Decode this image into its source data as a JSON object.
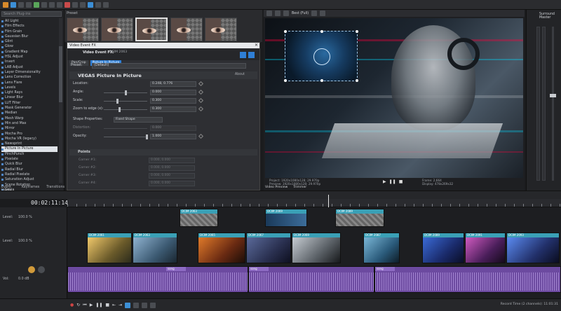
{
  "fx_list": {
    "search_placeholder": "Search Plug-ins",
    "items": [
      "All Light",
      "Film Effects",
      "Film Grain",
      "Gaussian Blur",
      "Glint",
      "Glow",
      "Gradient Map",
      "HSL Adjust",
      "Invert",
      "LAB Adjust",
      "Layer Dimensionality",
      "Lens Correction",
      "Lens Flare",
      "Levels",
      "Light Rays",
      "Linear Blur",
      "LUT Filter",
      "Mask Generator",
      "Median",
      "Mesh Warp",
      "Min and Max",
      "Mirror",
      "Mocha Pro",
      "Mocha VR (legacy)",
      "Newsprint",
      "Picture In Picture",
      "PinchPunch",
      "Pixelate",
      "Quick Blur",
      "Radial Blur",
      "Radial Pixelate",
      "Saturation Adjust",
      "Scene Rotation",
      "Sepia",
      "Sharpen"
    ],
    "selected_index": 25,
    "tabs": [
      "Event Media",
      "Keyframes",
      "Transitions"
    ]
  },
  "preset_panel": {
    "title": "Preset"
  },
  "fx_window": {
    "title": "Video Event FX",
    "header_label": "Video Event FX:",
    "header_sub": "DCIM 2063",
    "chain": [
      "Pan/Crop",
      "Picture In Picture"
    ],
    "preset_label": "Preset:",
    "preset_value": "(Default)",
    "plugin_name": "VEGAS Picture In Picture",
    "about_label": "About",
    "params": [
      {
        "label": "Location:",
        "value": "0.248, 0.776",
        "knob": null
      },
      {
        "label": "Angle:",
        "value": "0.000",
        "knob": 0.5
      },
      {
        "label": "Scale:",
        "value": "0.300",
        "knob": 0.3
      },
      {
        "label": "Zoom to edge (x):",
        "value": "0.300",
        "knob": 0.35
      },
      {
        "label": "Distortion:",
        "value": "0.000",
        "knob": null
      },
      {
        "label": "Opacity:",
        "value": "1.000",
        "knob": 1.0
      }
    ],
    "shape_label": "Shape Properties:",
    "shape_value": "Fixed Shape",
    "points_title": "Points",
    "points": [
      {
        "label": "Corner #1:",
        "value": "0.000, 0.000"
      },
      {
        "label": "Corner #2:",
        "value": "0.000, 0.000"
      },
      {
        "label": "Corner #3:",
        "value": "0.000, 0.000"
      },
      {
        "label": "Corner #4:",
        "value": "0.000, 0.000"
      }
    ]
  },
  "preview": {
    "zoom": "Best (Full)",
    "project": "Project:  1920x1080x128; 29.970p",
    "preview_res": "Preview:  1920x1080x128; 29.970p",
    "frame": "Frame:  2,664",
    "display": "Display:  478x269x32",
    "tabs": [
      "Video Preview",
      "Trimmer"
    ]
  },
  "meters": {
    "title": "Surround Master"
  },
  "timeline": {
    "timecode": "00:02:11:14",
    "tracks": [
      {
        "label": "Level:",
        "value": "100.0 %"
      },
      {
        "label": "Level:",
        "value": "100.0 %"
      },
      {
        "label": "Vol:",
        "value": "0.0 dB"
      }
    ],
    "clips_top": [
      {
        "label": "DCIM 2063"
      },
      {
        "label": "DCIM 2069"
      },
      {
        "label": "DCIM 2089"
      }
    ],
    "clips_main": [
      {
        "label": "DCIM 2061"
      },
      {
        "label": "DCIM 2063"
      },
      {
        "label": "DCIM 2065"
      },
      {
        "label": "DCIM 2067"
      },
      {
        "label": "DCIM 2069"
      },
      {
        "label": "DCIM 2087"
      },
      {
        "label": "DCIM 2089"
      },
      {
        "label": "DCIM 2091"
      },
      {
        "label": "DCIM 2093"
      }
    ],
    "audio_clips": [
      "song",
      "song",
      "song"
    ],
    "status": "Record Time (2 channels): 11:01:31"
  }
}
